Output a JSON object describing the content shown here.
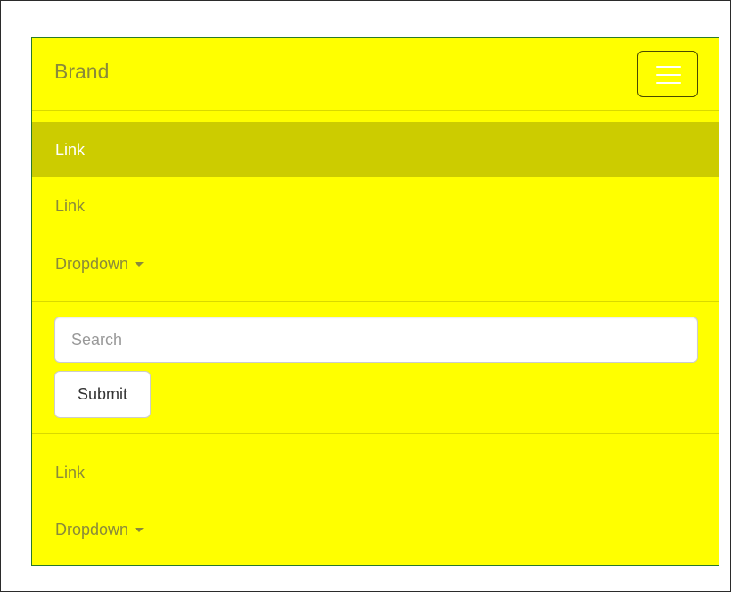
{
  "navbar": {
    "brand": "Brand",
    "toggle_icon": "hamburger-icon",
    "colors": {
      "background": "#ffff00",
      "active_background": "#cccc00",
      "text": "#8a8a3a",
      "active_text": "#ffffff",
      "border": "#2a7a2a"
    },
    "nav_primary": [
      {
        "label": "Link",
        "active": true
      },
      {
        "label": "Link",
        "active": false
      },
      {
        "label": "Dropdown",
        "has_caret": true
      }
    ],
    "search": {
      "placeholder": "Search",
      "value": ""
    },
    "submit_label": "Submit",
    "nav_secondary": [
      {
        "label": "Link"
      },
      {
        "label": "Dropdown",
        "has_caret": true
      }
    ],
    "caret_icon": "caret-down-icon"
  }
}
